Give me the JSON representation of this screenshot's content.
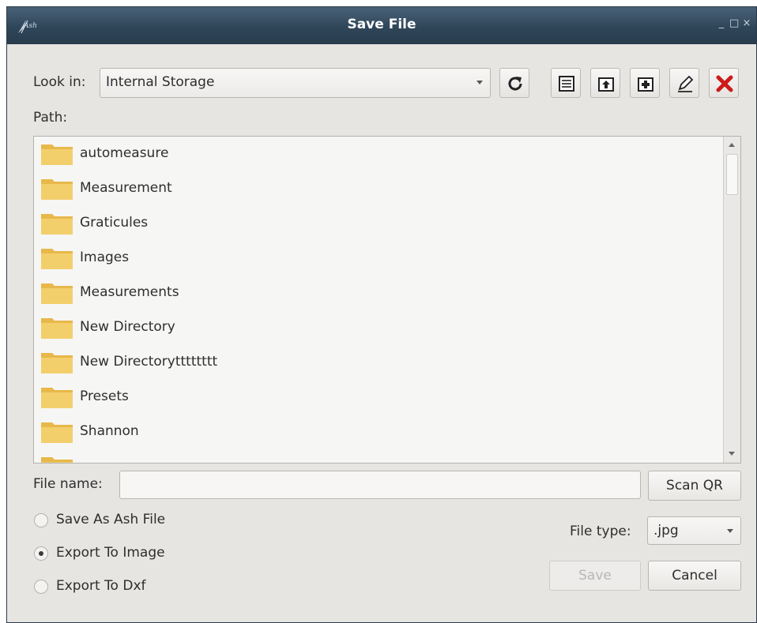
{
  "window": {
    "title": "Save File",
    "app_logo_text": "Ash",
    "controls": {
      "minimize": "_",
      "maximize": "□",
      "close": "×"
    }
  },
  "look_in": {
    "label": "Look in:",
    "value": "Internal Storage"
  },
  "toolbar": {
    "icons": [
      "refresh-icon",
      "detail-view-icon",
      "parent-directory-icon",
      "new-folder-icon",
      "rename-icon",
      "delete-icon"
    ]
  },
  "path": {
    "label": "Path:"
  },
  "files": [
    {
      "name": "automeasure",
      "icon": "folder-icon"
    },
    {
      "name": "Measurement",
      "icon": "folder-icon"
    },
    {
      "name": "Graticules",
      "icon": "folder-icon"
    },
    {
      "name": "Images",
      "icon": "folder-icon"
    },
    {
      "name": "Measurements",
      "icon": "folder-icon"
    },
    {
      "name": "New Directory",
      "icon": "folder-icon"
    },
    {
      "name": "New Directorytttttttt",
      "icon": "folder-icon"
    },
    {
      "name": "Presets",
      "icon": "folder-icon"
    },
    {
      "name": "Shannon",
      "icon": "folder-icon"
    },
    {
      "name": "",
      "icon": "folder-icon"
    }
  ],
  "file_name": {
    "label": "File name:",
    "value": ""
  },
  "scan_qr_label": "Scan QR",
  "save_options": [
    {
      "label": "Save As Ash File",
      "selected": false
    },
    {
      "label": "Export To Image",
      "selected": true
    },
    {
      "label": "Export To Dxf",
      "selected": false
    }
  ],
  "file_type": {
    "label": "File type:",
    "value": ".jpg"
  },
  "actions": {
    "save": "Save",
    "cancel": "Cancel",
    "save_enabled": false
  },
  "colors": {
    "titlebar": "#2f4659",
    "background": "#e7e5e2",
    "folder": "#f0c860",
    "delete": "#cc1b1b"
  }
}
